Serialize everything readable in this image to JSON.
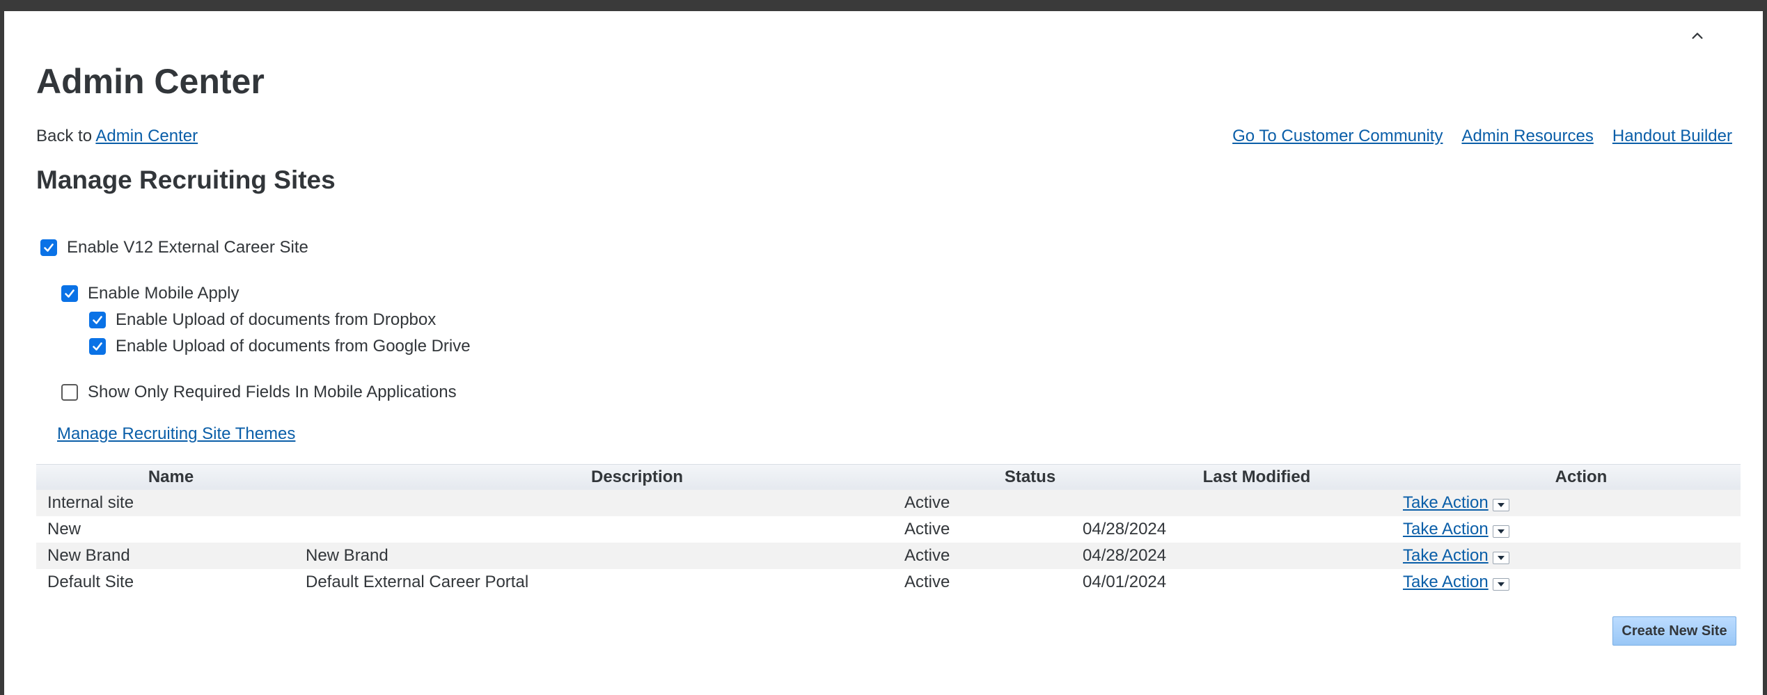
{
  "header": {
    "title": "Admin Center",
    "back_prefix": "Back to",
    "back_link": "Admin Center"
  },
  "top_links": [
    "Go To Customer Community",
    "Admin Resources",
    "Handout Builder"
  ],
  "section": {
    "title": "Manage Recruiting Sites"
  },
  "options": {
    "v12_external": {
      "label": "Enable V12 External Career Site",
      "checked": true
    },
    "mobile_apply": {
      "label": "Enable Mobile Apply",
      "checked": true
    },
    "dropbox": {
      "label": "Enable Upload of documents from Dropbox",
      "checked": true
    },
    "google_drive": {
      "label": "Enable Upload of documents from Google Drive",
      "checked": true
    },
    "required_fields": {
      "label": "Show Only Required Fields In Mobile Applications",
      "checked": false
    }
  },
  "themes_link": "Manage Recruiting Site Themes",
  "table": {
    "headers": {
      "name": "Name",
      "description": "Description",
      "status": "Status",
      "last_modified": "Last Modified",
      "action": "Action"
    },
    "rows": [
      {
        "name": "Internal site",
        "description": "",
        "status": "Active",
        "last_modified": "",
        "action": "Take Action"
      },
      {
        "name": "New",
        "description": "",
        "status": "Active",
        "last_modified": "04/28/2024",
        "action": "Take Action"
      },
      {
        "name": "New Brand",
        "description": "New Brand",
        "status": "Active",
        "last_modified": "04/28/2024",
        "action": "Take Action"
      },
      {
        "name": "Default Site",
        "description": "Default External Career Portal",
        "status": "Active",
        "last_modified": "04/01/2024",
        "action": "Take Action"
      }
    ]
  },
  "create_button": "Create New Site",
  "icons": {
    "collapse": "chevron-up-icon",
    "dropdown": "chevron-down-icon",
    "check": "checkmark-icon"
  },
  "colors": {
    "link": "#0a5ea8",
    "checkbox": "#0a72e6",
    "button": "#99c7f6"
  }
}
